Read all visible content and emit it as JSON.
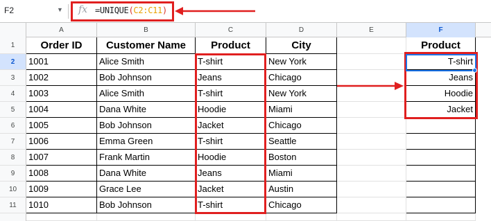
{
  "formula_bar": {
    "name_box": "F2",
    "fx": "fx",
    "formula_prefix": "=UNIQUE",
    "formula_open": "(",
    "formula_ref": "C2:C11",
    "formula_close": ")"
  },
  "columns": [
    "A",
    "B",
    "C",
    "D",
    "E",
    "F"
  ],
  "rows": [
    "1",
    "2",
    "3",
    "4",
    "5",
    "6",
    "7",
    "8",
    "9",
    "10",
    "11"
  ],
  "table": {
    "headers": [
      "Order ID",
      "Customer Name",
      "Product",
      "City"
    ],
    "data": [
      [
        "1001",
        "Alice Smith",
        "T-shirt",
        "New York"
      ],
      [
        "1002",
        "Bob Johnson",
        "Jeans",
        "Chicago"
      ],
      [
        "1003",
        "Alice Smith",
        "T-shirt",
        "New York"
      ],
      [
        "1004",
        "Dana White",
        "Hoodie",
        "Miami"
      ],
      [
        "1005",
        "Bob Johnson",
        "Jacket",
        "Chicago"
      ],
      [
        "1006",
        "Emma Green",
        "T-shirt",
        "Seattle"
      ],
      [
        "1007",
        "Frank Martin",
        "Hoodie",
        "Boston"
      ],
      [
        "1008",
        "Dana White",
        "Jeans",
        "Miami"
      ],
      [
        "1009",
        "Grace Lee",
        "Jacket",
        "Austin"
      ],
      [
        "1010",
        "Bob Johnson",
        "T-shirt",
        "Chicago"
      ]
    ]
  },
  "unique": {
    "header": "Product",
    "values": [
      "T-shirt",
      "Jeans",
      "Hoodie",
      "Jacket"
    ]
  },
  "colors": {
    "annotation": "#e01f1f",
    "selection": "#1a73e8"
  }
}
